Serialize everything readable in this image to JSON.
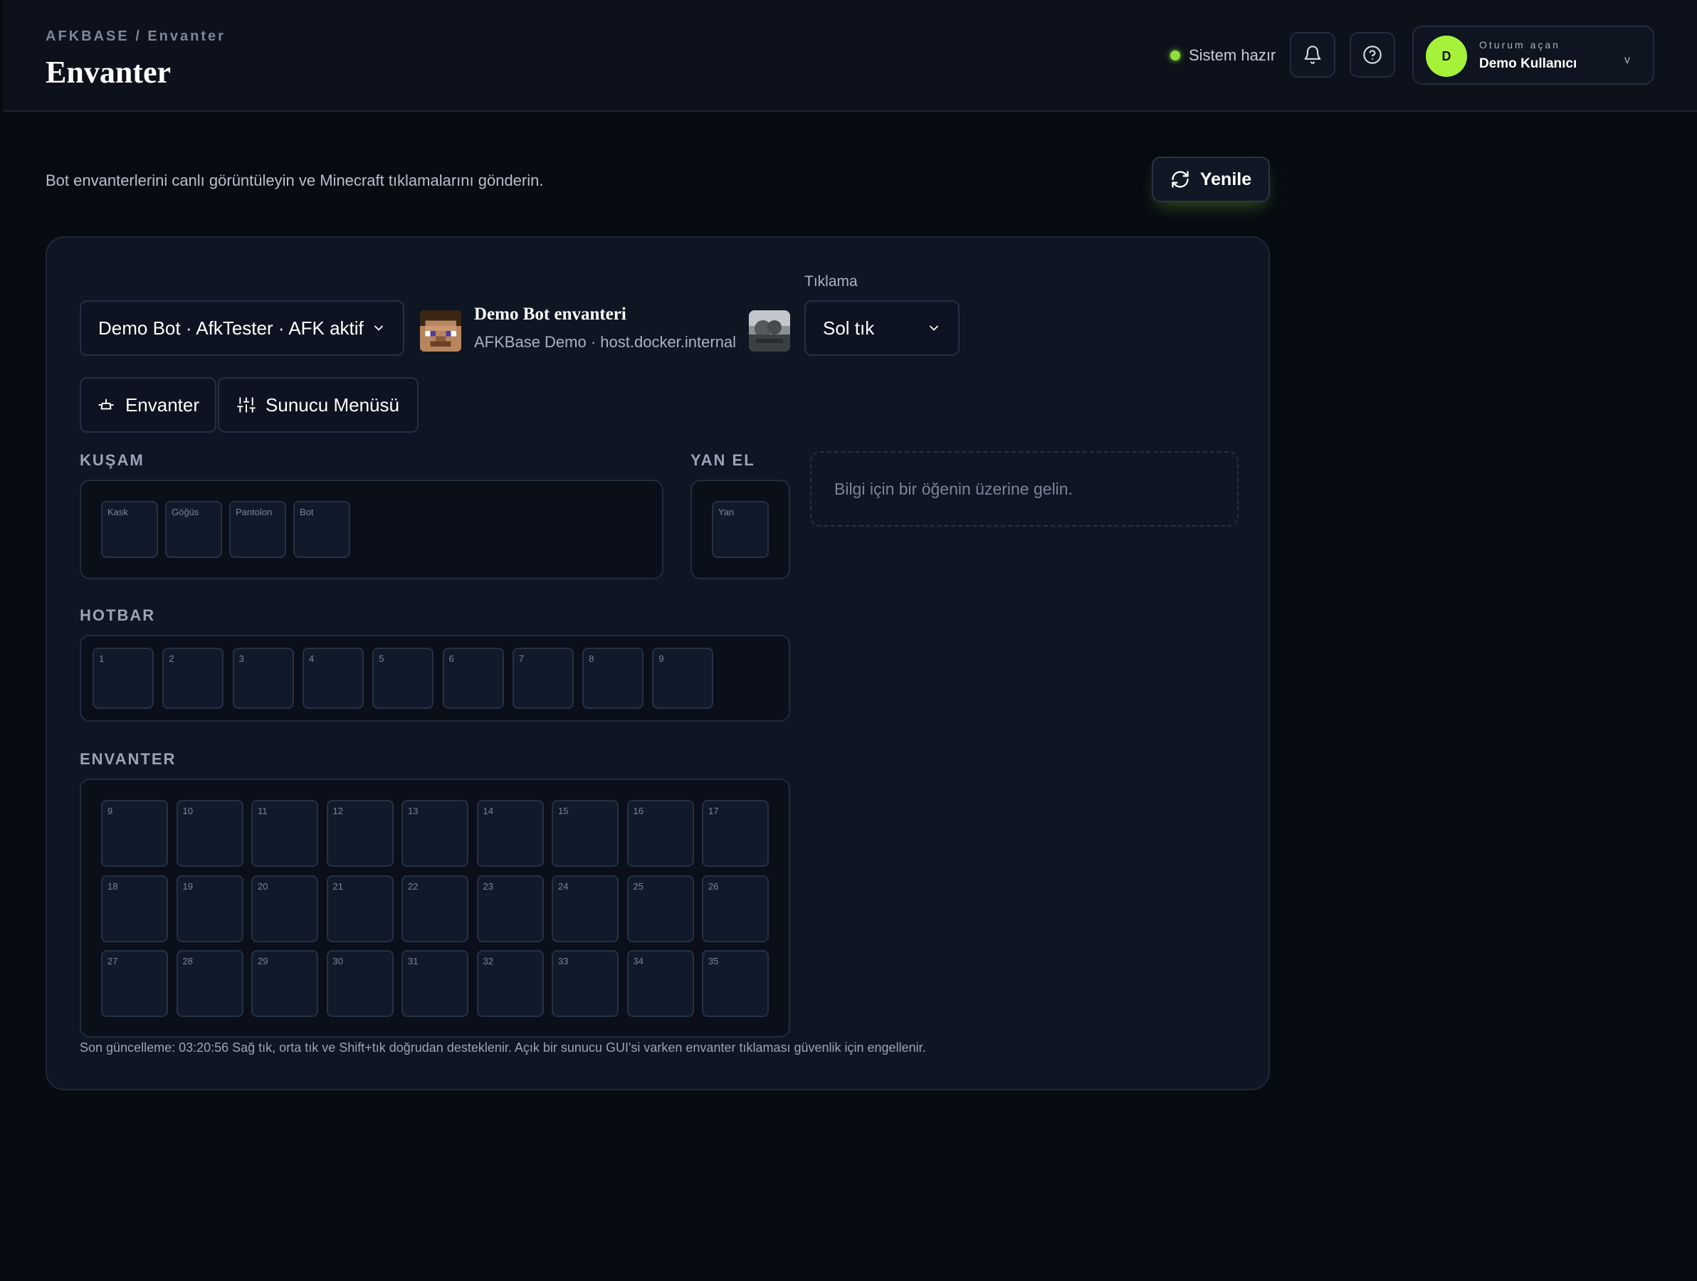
{
  "header": {
    "breadcrumb": "AFKBASE / Envanter",
    "title": "Envanter",
    "status_text": "Sistem hazır",
    "status_color": "#8fe03a",
    "notification_icon": "bell-icon",
    "help_icon": "help-circle-icon",
    "user": {
      "initial": "D",
      "caption": "Oturum açan",
      "name": "Demo Kullanıcı",
      "chevron": "v"
    }
  },
  "intro": {
    "text": "Bot envanterlerini canlı görüntüleyin ve Minecraft tıklamalarını gönderin.",
    "refresh_label": "Yenile"
  },
  "toolbar": {
    "bot_select_value": "Demo Bot · AfkTester · AFK aktif",
    "bot_title": "Demo Bot envanteri",
    "bot_subtitle": "AFKBase Demo · host.docker.internal",
    "click_label": "Tıklama",
    "click_select_value": "Sol tık",
    "tabs": [
      {
        "label": "Envanter",
        "icon": "inventory-icon"
      },
      {
        "label": "Sunucu Menüsü",
        "icon": "sliders-icon"
      }
    ]
  },
  "armor": {
    "title": "KUŞAM",
    "slots": [
      "Kask",
      "Göğüs",
      "Pantolon",
      "Bot"
    ]
  },
  "offhand": {
    "title": "YAN EL",
    "slot": "Yan"
  },
  "hover_info": "Bilgi için bir öğenin üzerine gelin.",
  "hotbar": {
    "title": "HOTBAR",
    "slots": [
      "1",
      "2",
      "3",
      "4",
      "5",
      "6",
      "7",
      "8",
      "9"
    ]
  },
  "inventory": {
    "title": "ENVANTER",
    "slots": [
      "9",
      "10",
      "11",
      "12",
      "13",
      "14",
      "15",
      "16",
      "17",
      "18",
      "19",
      "20",
      "21",
      "22",
      "23",
      "24",
      "25",
      "26",
      "27",
      "28",
      "29",
      "30",
      "31",
      "32",
      "33",
      "34",
      "35"
    ]
  },
  "footnote": "Son güncelleme: 03:20:56 Sağ tık, orta tık ve Shift+tık doğrudan desteklenir. Açık bir sunucu GUI'si varken envanter tıklaması güvenlik için engellenir."
}
